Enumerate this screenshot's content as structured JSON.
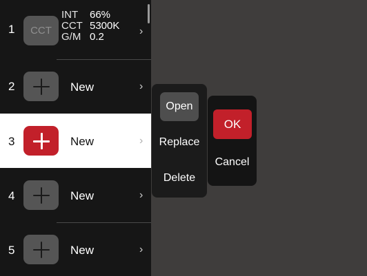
{
  "colors": {
    "background": "#3f3d3c",
    "list_background": "#161616",
    "accent_red": "#c2202a",
    "selected_row": "#ffffff"
  },
  "preset_list": {
    "rows": [
      {
        "number": "1",
        "tile_text": "CCT",
        "tile_icon": "cct-badge-icon",
        "info": [
          {
            "key": "INT",
            "value": "66%"
          },
          {
            "key": "CCT",
            "value": "5300K"
          },
          {
            "key": "G/M",
            "value": "0.2"
          }
        ]
      },
      {
        "number": "2",
        "tile_icon": "plus-icon",
        "label": "New"
      },
      {
        "number": "3",
        "tile_icon": "plus-icon",
        "label": "New",
        "selected": true
      },
      {
        "number": "4",
        "tile_icon": "plus-icon",
        "label": "New"
      },
      {
        "number": "5",
        "tile_icon": "plus-icon",
        "label": "New"
      }
    ],
    "chevron": "›"
  },
  "context_menu": {
    "items": [
      "Open",
      "Replace",
      "Delete"
    ],
    "active_item": "Open"
  },
  "confirm_dialog": {
    "ok_label": "OK",
    "cancel_label": "Cancel"
  }
}
